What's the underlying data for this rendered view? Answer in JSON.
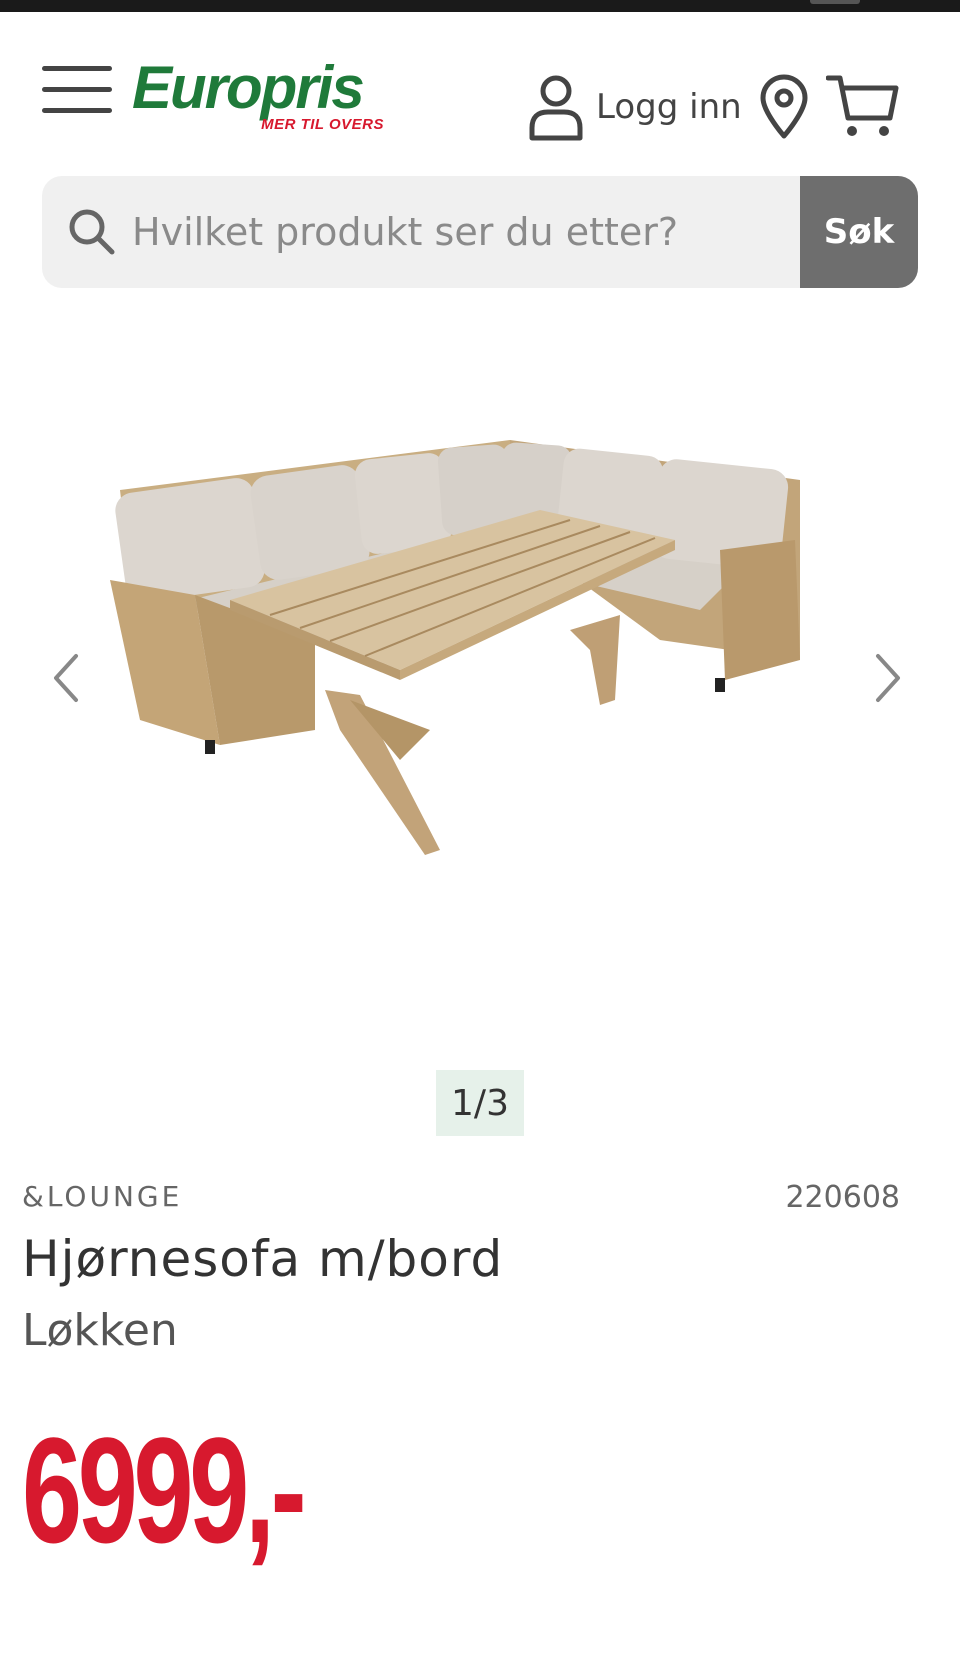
{
  "header": {
    "logo_text": "Europris",
    "logo_tagline": "MER TIL OVERS",
    "login_label": "Logg inn"
  },
  "search": {
    "placeholder": "Hvilket produkt ser du etter?",
    "button_label": "Søk"
  },
  "gallery": {
    "counter": "1/3"
  },
  "product": {
    "brand": "&LOUNGE",
    "sku": "220608",
    "title": "Hjørnesofa m/bord",
    "subtitle": "Løkken",
    "price": "6999,-"
  },
  "colors": {
    "brand_green": "#1f7a3a",
    "brand_red": "#d7192e",
    "search_button": "#6e6e6e",
    "counter_bg": "#e6f1ea"
  },
  "icons": [
    "menu-icon",
    "user-icon",
    "location-pin-icon",
    "cart-icon",
    "search-icon",
    "chevron-left-icon",
    "chevron-right-icon"
  ]
}
